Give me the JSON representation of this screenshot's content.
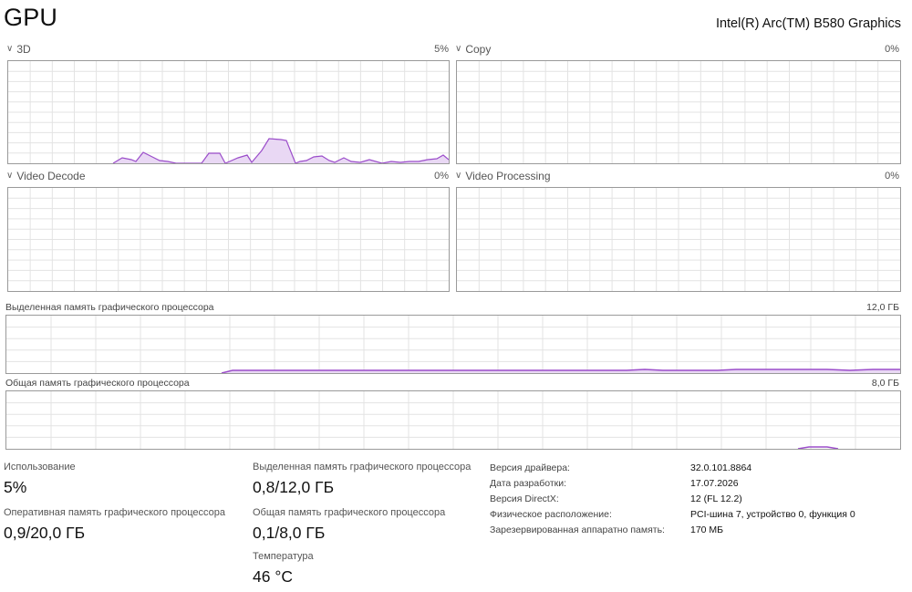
{
  "header": {
    "title": "GPU",
    "device": "Intel(R) Arc(TM) B580 Graphics"
  },
  "graphs": {
    "g3d": {
      "label": "3D",
      "value": "5%",
      "usage_percent": 5
    },
    "copy": {
      "label": "Copy",
      "value": "0%",
      "usage_percent": 0
    },
    "video_decode": {
      "label": "Video Decode",
      "value": "0%",
      "usage_percent": 0
    },
    "video_processing": {
      "label": "Video Processing",
      "value": "0%",
      "usage_percent": 0
    },
    "dedicated_memory": {
      "label": "Выделенная память графического процессора",
      "value": "12,0 ГБ"
    },
    "shared_memory": {
      "label": "Общая память графического процессора",
      "value": "8,0 ГБ"
    }
  },
  "stats": {
    "utilization": {
      "label": "Использование",
      "value": "5%"
    },
    "gpu_ram": {
      "label": "Оперативная память графического процессора",
      "value": "0,9/20,0 ГБ"
    },
    "dedicated": {
      "label": "Выделенная память графического процессора",
      "value": "0,8/12,0 ГБ"
    },
    "shared": {
      "label": "Общая память графического процессора",
      "value": "0,1/8,0 ГБ"
    },
    "temperature": {
      "label": "Температура",
      "value": "46 °C"
    }
  },
  "properties": [
    {
      "key": "Версия драйвера:",
      "value": "32.0.101.8864"
    },
    {
      "key": "Дата разработки:",
      "value": "17.07.2026"
    },
    {
      "key": "Версия DirectX:",
      "value": "12 (FL 12.2)"
    },
    {
      "key": "Физическое расположение:",
      "value": "PCI-шина 7, устройство 0, функция 0"
    },
    {
      "key": "Зарезервированная аппаратно память:",
      "value": "170 МБ"
    }
  ],
  "colors": {
    "line": "#9b4dca",
    "fill": "#e9d8f4",
    "grid": "#e3e3e3",
    "border": "#9a9a9a"
  }
}
